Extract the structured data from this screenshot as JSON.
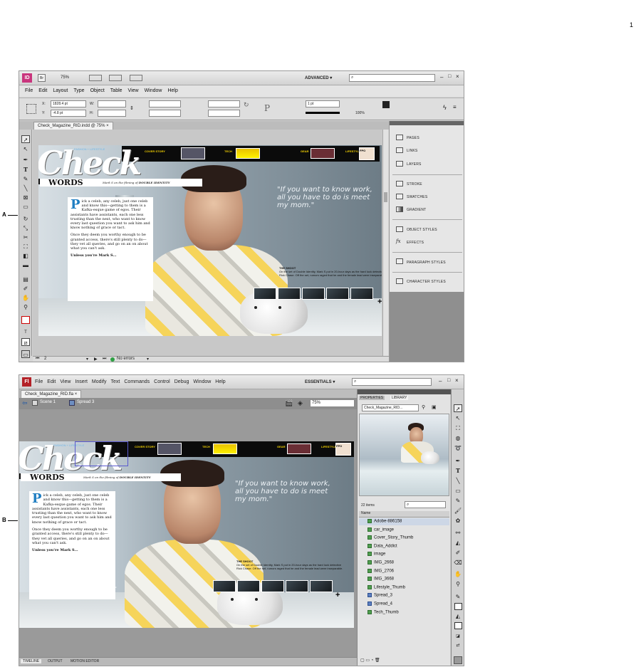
{
  "page_number": "1",
  "callouts": {
    "a": "A",
    "b": "B"
  },
  "indesign": {
    "app_icon": "ID",
    "bridge_icon": "Br",
    "zoom": "75%",
    "workspace": "ADVANCED ▾",
    "search_placeholder": "",
    "menu": [
      "File",
      "Edit",
      "Layout",
      "Type",
      "Object",
      "Table",
      "View",
      "Window",
      "Help"
    ],
    "control": {
      "x_label": "X:",
      "x_value": "1828.4 pt",
      "y_label": "Y:",
      "y_value": "-4.8 pt",
      "w_label": "W:",
      "h_label": "H:",
      "stroke_weight": "1 pt",
      "opacity": "100%"
    },
    "doc_tab": "Check_Magazine_RID.indd @ 75%",
    "doc_tab_close": "×",
    "panels": [
      "PAGES",
      "LINKS",
      "LAYERS",
      "STROKE",
      "SWATCHES",
      "GRADIENT",
      "OBJECT STYLES",
      "EFFECTS",
      "PARAGRAPH STYLES",
      "CHARACTER STYLES"
    ],
    "status": {
      "page": "2",
      "errors": "No errors"
    }
  },
  "flash": {
    "app_icon": "Fl",
    "workspace": "ESSENTIALS ▾",
    "menu": [
      "File",
      "Edit",
      "View",
      "Insert",
      "Modify",
      "Text",
      "Commands",
      "Control",
      "Debug",
      "Window",
      "Help"
    ],
    "doc_tab": "Check_Magazine_RID.fla",
    "doc_tab_close": "×",
    "breadcrumb_scene": "Scene 1",
    "breadcrumb_spread": "Spread 3",
    "zoom": "75%",
    "panel_tabs": [
      "PROPERTIES",
      "LIBRARY"
    ],
    "library_file": "Check_Magazine_RID...",
    "item_count": "22 items",
    "name_header": "Name",
    "library_items": [
      "Adobe-886158",
      "car_image",
      "Cover_Story_Thumb",
      "Data_Addict",
      "image",
      "IMG_2668",
      "IMG_2706",
      "IMG_3668",
      "Lifestyle_Thumb",
      "Spread_3",
      "Spread_4",
      "Tech_Thumb"
    ],
    "library_item_types": [
      "bitmap",
      "bitmap",
      "bitmap",
      "bitmap",
      "bitmap",
      "bitmap",
      "bitmap",
      "bitmap",
      "bitmap",
      "symbol",
      "symbol",
      "bitmap"
    ],
    "bottom_tabs": [
      "TIMELINE",
      "OUTPUT",
      "MOTION EDITOR"
    ]
  },
  "magazine": {
    "logo": "Check",
    "tagline": "FASHION + LIFESTYLE",
    "nav": [
      "COVER STORY",
      "TECH",
      "GEAR",
      "LIFESTYLE"
    ],
    "nav_badge": "FPO",
    "words_title": "WORDS",
    "words_subtitle": "Mark S on the filming of",
    "words_subtitle_bold": "DOUBLE IDENTITY",
    "body_dropcap": "P",
    "body_p1": "ick a celeb, any celeb, just one celeb and know this—getting to them is a Kafka-esque game of egos. Their assistants have assistants, each one less trusting than the next, who want to know every last question you want to ask him and know nothing of grace or tact.",
    "body_p2": "Once they deem you worthy enough to be granted access, there's still plenty to do—they vet all queries, and go on an on about what you can't ask.",
    "body_p3": "Unless you're Mark S...",
    "quote": "\"If you want to know work, all you have to do is meet my mom.\"",
    "shoot_title": "THE SHOOT",
    "shoot_text": "On the set of Double Identity, Mark S put in 20-hour days as the hard luck detective Rick Chase. Off the set, rumors raged that he and the female lead were inseparable.",
    "plus_glyph": "+"
  },
  "colors": {
    "accent_blue": "#1f7ec2",
    "nav_yellow": "#f4d200",
    "indesign_icon": "#c9357d",
    "flash_icon": "#b42127"
  }
}
